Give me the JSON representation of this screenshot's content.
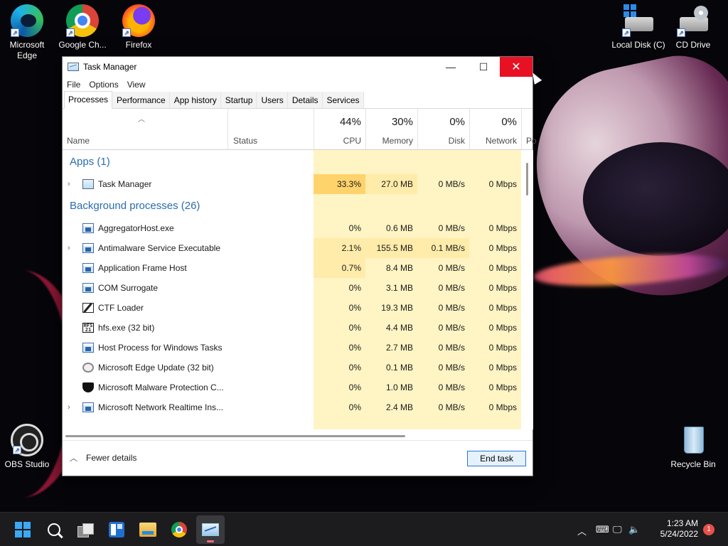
{
  "desktop": {
    "icons": [
      {
        "label": "Microsoft Edge",
        "icon": "edge-icon"
      },
      {
        "label": "Google Ch...",
        "icon": "chrome-icon"
      },
      {
        "label": "Firefox",
        "icon": "firefox-icon"
      },
      {
        "label": "Local Disk (C)",
        "icon": "local-disk-icon"
      },
      {
        "label": "CD Drive",
        "icon": "cd-drive-icon"
      },
      {
        "label": "OBS Studio",
        "icon": "obs-icon"
      },
      {
        "label": "Recycle Bin",
        "icon": "recycle-bin-icon"
      }
    ]
  },
  "window": {
    "title": "Task Manager",
    "controls": {
      "minimize": "—",
      "maximize": "☐",
      "close": "✕"
    },
    "menu": [
      "File",
      "Options",
      "View"
    ],
    "tabs": [
      "Processes",
      "Performance",
      "App history",
      "Startup",
      "Users",
      "Details",
      "Services"
    ],
    "active_tab": "Processes"
  },
  "columns": {
    "name": "Name",
    "status": "Status",
    "cpu": {
      "pct": "44%",
      "label": "CPU"
    },
    "memory": {
      "pct": "30%",
      "label": "Memory"
    },
    "disk": {
      "pct": "0%",
      "label": "Disk"
    },
    "network": {
      "pct": "0%",
      "label": "Network"
    },
    "power_partial": "Po"
  },
  "groups": {
    "apps": "Apps (1)",
    "background": "Background processes (26)"
  },
  "apps": [
    {
      "name": "Task Manager",
      "expandable": true,
      "icon": "task-manager-icon",
      "cpu": "33.3%",
      "memory": "27.0 MB",
      "disk": "0 MB/s",
      "network": "0 Mbps"
    }
  ],
  "background": [
    {
      "name": "AggregatorHost.exe",
      "expandable": false,
      "icon": "app-window-icon",
      "cpu": "0%",
      "memory": "0.6 MB",
      "disk": "0 MB/s",
      "network": "0 Mbps"
    },
    {
      "name": "Antimalware Service Executable",
      "expandable": true,
      "icon": "app-window-icon",
      "cpu": "2.1%",
      "memory": "155.5 MB",
      "disk": "0.1 MB/s",
      "network": "0 Mbps"
    },
    {
      "name": "Application Frame Host",
      "expandable": false,
      "icon": "app-window-icon",
      "cpu": "0.7%",
      "memory": "8.4 MB",
      "disk": "0 MB/s",
      "network": "0 Mbps"
    },
    {
      "name": "COM Surrogate",
      "expandable": false,
      "icon": "app-window-icon",
      "cpu": "0%",
      "memory": "3.1 MB",
      "disk": "0 MB/s",
      "network": "0 Mbps"
    },
    {
      "name": "CTF Loader",
      "expandable": false,
      "icon": "ctf-loader-icon",
      "cpu": "0%",
      "memory": "19.3 MB",
      "disk": "0 MB/s",
      "network": "0 Mbps"
    },
    {
      "name": "hfs.exe (32 bit)",
      "expandable": false,
      "icon": "hfs-icon",
      "cpu": "0%",
      "memory": "4.4 MB",
      "disk": "0 MB/s",
      "network": "0 Mbps"
    },
    {
      "name": "Host Process for Windows Tasks",
      "expandable": false,
      "icon": "app-window-icon",
      "cpu": "0%",
      "memory": "2.7 MB",
      "disk": "0 MB/s",
      "network": "0 Mbps"
    },
    {
      "name": "Microsoft Edge Update (32 bit)",
      "expandable": false,
      "icon": "edge-update-icon",
      "cpu": "0%",
      "memory": "0.1 MB",
      "disk": "0 MB/s",
      "network": "0 Mbps"
    },
    {
      "name": "Microsoft Malware Protection C...",
      "expandable": false,
      "icon": "shield-icon",
      "cpu": "0%",
      "memory": "1.0 MB",
      "disk": "0 MB/s",
      "network": "0 Mbps"
    },
    {
      "name": "Microsoft Network Realtime Ins...",
      "expandable": true,
      "icon": "app-window-icon",
      "cpu": "0%",
      "memory": "2.4 MB",
      "disk": "0 MB/s",
      "network": "0 Mbps"
    }
  ],
  "footer": {
    "fewer_details": "Fewer details",
    "end_task": "End task"
  },
  "taskbar": {
    "items": [
      "start-icon",
      "search-icon",
      "task-view-icon",
      "widgets-icon",
      "file-explorer-icon",
      "chrome-icon",
      "task-manager-icon"
    ],
    "active_item": "task-manager-icon",
    "tray": {
      "time": "1:23 AM",
      "date": "5/24/2022",
      "notifications": "1"
    }
  },
  "colors": {
    "close_button": "#e81123",
    "heat_low": "#fff4c4",
    "heat_mid": "#ffecaa",
    "heat_high": "#ffd36b",
    "group_title": "#2b6cb0",
    "end_task_border": "#2b78d6"
  }
}
